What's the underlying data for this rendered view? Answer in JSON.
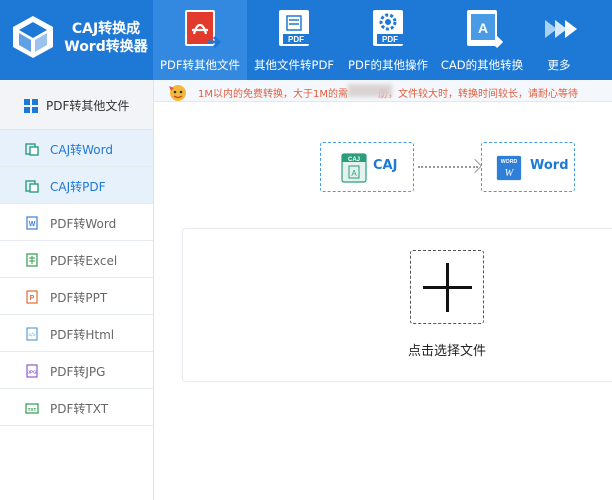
{
  "brand": {
    "line1": "CAJ转换成",
    "line2": "Word转换器"
  },
  "nav": [
    {
      "label": "PDF转其他文件",
      "icon": "pdf-export-icon",
      "active": true
    },
    {
      "label": "其他文件转PDF",
      "icon": "doc-to-pdf-icon",
      "active": false
    },
    {
      "label": "PDF的其他操作",
      "icon": "pdf-settings-icon",
      "active": false
    },
    {
      "label": "CAD的其他转换",
      "icon": "cad-convert-icon",
      "active": false
    },
    {
      "label": "更多",
      "icon": "double-arrow-icon",
      "active": false
    }
  ],
  "notice": {
    "text": "1M以内的免费转换，大于1M的需　　　册，文件较大时，转换时间较长，请耐心等待"
  },
  "sidebar": {
    "header": "PDF转其他文件",
    "items": [
      {
        "label": "CAJ转Word",
        "icon": "caj-icon",
        "active": true
      },
      {
        "label": "CAJ转PDF",
        "icon": "caj-icon",
        "active": true
      },
      {
        "label": "PDF转Word",
        "icon": "word-icon",
        "active": false
      },
      {
        "label": "PDF转Excel",
        "icon": "excel-icon",
        "active": false
      },
      {
        "label": "PDF转PPT",
        "icon": "ppt-icon",
        "active": false
      },
      {
        "label": "PDF转Html",
        "icon": "html-icon",
        "active": false
      },
      {
        "label": "PDF转JPG",
        "icon": "jpg-icon",
        "active": false
      },
      {
        "label": "PDF转TXT",
        "icon": "txt-icon",
        "active": false
      }
    ]
  },
  "flow": {
    "source": {
      "label": "CAJ",
      "badge": "CAJ"
    },
    "target": {
      "label": "Word",
      "badge": "WORD"
    }
  },
  "upload": {
    "label": "点击选择文件"
  },
  "colors": {
    "accent": "#1e78d6",
    "notice": "#e25d3c"
  }
}
